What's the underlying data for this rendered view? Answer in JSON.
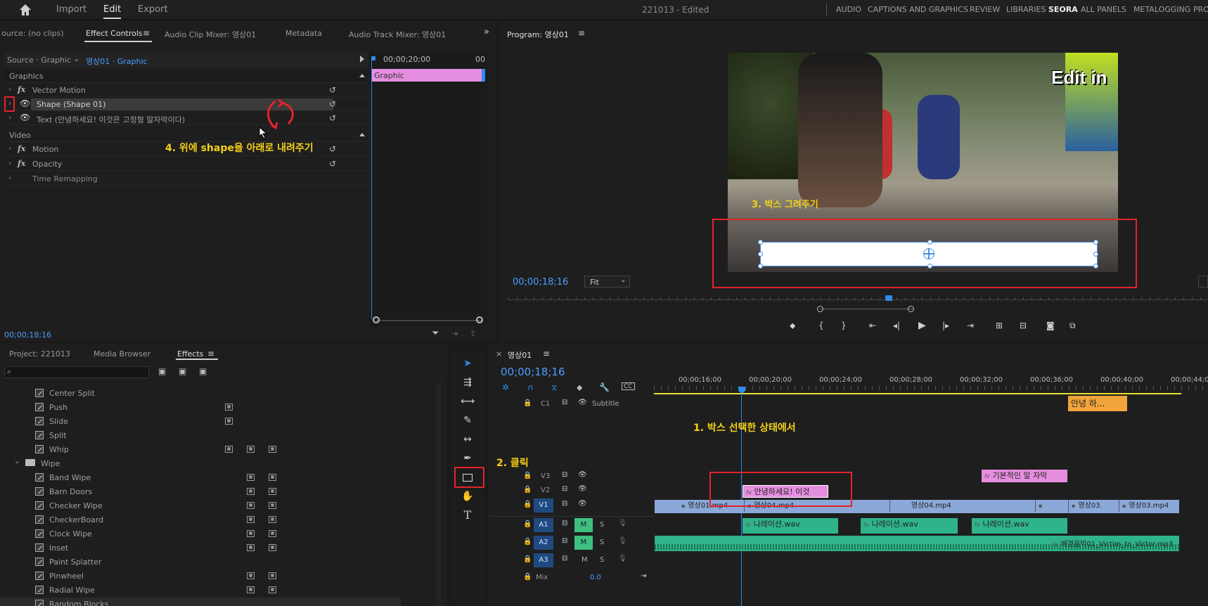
{
  "topbar": {
    "nav": [
      "Import",
      "Edit",
      "Export"
    ],
    "active_nav": "Edit",
    "doc_title": "221013",
    "doc_status": "- Edited",
    "workspaces": [
      "AUDIO",
      "CAPTIONS AND GRAPHICS",
      "REVIEW",
      "LIBRARIES",
      "SEORA",
      "ALL PANELS",
      "METALOGGING",
      "PRO"
    ]
  },
  "effect_controls": {
    "tabs": [
      "ource: (no clips)",
      "Effect Controls",
      "Audio Clip Mixer: 영상01",
      "Metadata",
      "Audio Track Mixer: 영상01"
    ],
    "source_label": "Source · Graphic",
    "clip_label": "영상01 · Graphic",
    "mini_time": "00;00;20;00",
    "mini_time_end": "00",
    "graphic_bar": "Graphic",
    "section_graphics": "Graphics",
    "section_video": "Video",
    "rows_graphics": [
      "Vector Motion",
      "Shape (Shape 01)",
      "Text (안녕하세요! 이것은 고정형 말자막이다)"
    ],
    "rows_video": [
      "Motion",
      "Opacity",
      "Time Remapping"
    ],
    "timecode": "00;00;18;16",
    "annotation": "4. 위에 shape을 아래로 내려주기"
  },
  "program": {
    "title": "Program: 영상01",
    "timecode": "00;00;18;16",
    "fit": "Fit",
    "watermark": "Edit in",
    "annotation": "3. 박스 그려주기"
  },
  "project": {
    "tabs": [
      "Project: 221013",
      "Media Browser",
      "Effects"
    ],
    "active_tab": "Effects",
    "items": [
      "Center Split",
      "Push",
      "Slide",
      "Split",
      "Whip"
    ],
    "folder": "Wipe",
    "wipe_items": [
      "Band Wipe",
      "Barn Doors",
      "Checker Wipe",
      "CheckerBoard",
      "Clock Wipe",
      "Inset",
      "Paint Splatter",
      "Pinwheel",
      "Radial Wipe",
      "Random Blocks"
    ]
  },
  "timeline": {
    "title": "영상01",
    "timecode": "00;00;18;16",
    "ruler": [
      "00;00;16;00",
      "00;00;20;00",
      "00;00;24;00",
      "00;00;28;00",
      "00;00;32;00",
      "00;00;36;00",
      "00;00;40;00",
      "00;00;44;00"
    ],
    "tracks": {
      "c1": "C1",
      "c1_name": "Subtitle",
      "v3": "V3",
      "v2": "V2",
      "v1": "V1",
      "a1": "A1",
      "a2": "A2",
      "a3": "A3",
      "mix": "Mix",
      "mix_val": "0.0",
      "m": "M",
      "s": "S"
    },
    "clips": {
      "subtitle": "안녕 하...",
      "v3": "기본적인 말 자막",
      "v2": "안녕하세요! 이것",
      "v1": [
        "영상01.mp4",
        "영상04.mp4",
        "영상04.mp4",
        "영상03.",
        "영상03.mp4"
      ],
      "a1": [
        "나레이션.wav",
        "나레이션.wav",
        "나레이션.wav"
      ],
      "a2": "배경음악01_Victim_to_Victor.mp3"
    },
    "annotation1": "1. 박스 선택한 상태에서",
    "annotation2": "2. 클릭"
  },
  "colors": {
    "accent": "#2d8ceb",
    "annotation": "#f5d117",
    "highlight": "#e3232c",
    "graphic_clip": "#e58ee0",
    "video_clip": "#8aa8d8",
    "audio_clip": "#2fb38a",
    "subtitle_clip": "#f0a43a"
  }
}
